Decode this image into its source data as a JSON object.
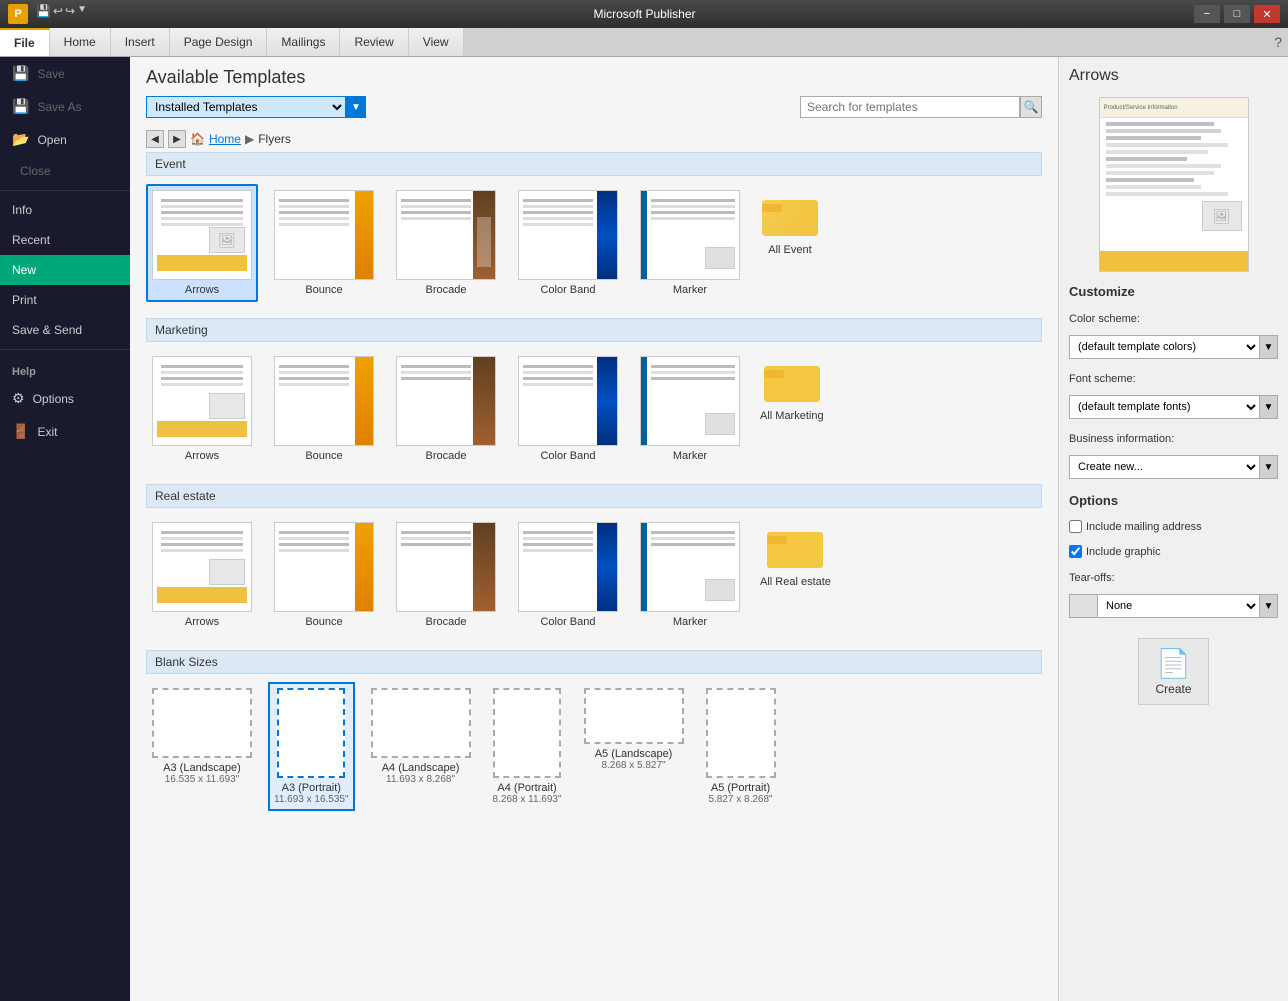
{
  "titlebar": {
    "icon": "P",
    "title": "Microsoft Publisher",
    "minimize": "−",
    "maximize": "□",
    "close": "✕"
  },
  "ribbon": {
    "tabs": [
      {
        "label": "File",
        "active": true
      },
      {
        "label": "Home",
        "active": false
      },
      {
        "label": "Insert",
        "active": false
      },
      {
        "label": "Page Design",
        "active": false
      },
      {
        "label": "Mailings",
        "active": false
      },
      {
        "label": "Review",
        "active": false
      },
      {
        "label": "View",
        "active": false
      }
    ]
  },
  "sidebar": {
    "items": [
      {
        "label": "Save",
        "icon": "💾",
        "disabled": true
      },
      {
        "label": "Save As",
        "icon": "💾",
        "disabled": true
      },
      {
        "label": "Open",
        "icon": "📂",
        "disabled": false
      },
      {
        "label": "Close",
        "icon": "✕",
        "disabled": true
      },
      {
        "label": "Info",
        "section": true
      },
      {
        "label": "Recent",
        "section": true
      },
      {
        "label": "New",
        "active": true
      },
      {
        "label": "Print",
        "section": true
      },
      {
        "label": "Save & Send",
        "section": true
      },
      {
        "label": "Help",
        "section_header": true
      },
      {
        "label": "Options",
        "icon": "⚙"
      },
      {
        "label": "Exit",
        "icon": "✕"
      }
    ]
  },
  "main": {
    "title": "Available Templates",
    "template_source": "Installed Templates",
    "search_placeholder": "Search for templates",
    "breadcrumb": {
      "home": "Home",
      "current": "Flyers"
    },
    "sections": [
      {
        "name": "Event",
        "templates": [
          {
            "label": "Arrows",
            "selected": true,
            "type": "arrows"
          },
          {
            "label": "Bounce",
            "type": "bounce"
          },
          {
            "label": "Brocade",
            "type": "brocade"
          },
          {
            "label": "Color Band",
            "type": "colorband"
          },
          {
            "label": "Marker",
            "type": "marker"
          }
        ],
        "folder": {
          "label": "All Event"
        }
      },
      {
        "name": "Marketing",
        "templates": [
          {
            "label": "Arrows",
            "selected": false,
            "type": "arrows"
          },
          {
            "label": "Bounce",
            "type": "bounce"
          },
          {
            "label": "Brocade",
            "type": "brocade"
          },
          {
            "label": "Color Band",
            "type": "colorband"
          },
          {
            "label": "Marker",
            "type": "marker"
          }
        ],
        "folder": {
          "label": "All Marketing"
        }
      },
      {
        "name": "Real estate",
        "templates": [
          {
            "label": "Arrows",
            "selected": false,
            "type": "arrows"
          },
          {
            "label": "Bounce",
            "type": "bounce"
          },
          {
            "label": "Brocade",
            "type": "brocade"
          },
          {
            "label": "Color Band",
            "type": "colorband"
          },
          {
            "label": "Marker",
            "type": "marker"
          }
        ],
        "folder": {
          "label": "All Real estate"
        }
      },
      {
        "name": "Blank Sizes",
        "blanks": [
          {
            "label": "A3 (Landscape)",
            "size": "16.535 x 11.693\"",
            "shape": "land"
          },
          {
            "label": "A3 (Portrait)",
            "size": "11.693 x 16.535\"",
            "shape": "port",
            "selected": true
          },
          {
            "label": "A4 (Landscape)",
            "size": "11.693 x 8.268\"",
            "shape": "land"
          },
          {
            "label": "A4 (Portrait)",
            "size": "8.268 x 11.693\"",
            "shape": "port"
          },
          {
            "label": "A5 (Landscape)",
            "size": "8.268 x 5.827\"",
            "shape": "land5"
          },
          {
            "label": "A5 (Portrait)",
            "size": "5.827 x 8.268\"",
            "shape": "port5"
          }
        ]
      }
    ]
  },
  "right_panel": {
    "title": "Arrows",
    "customize": {
      "title": "Customize",
      "color_scheme_label": "Color scheme:",
      "color_scheme_value": "(default template colors)",
      "font_scheme_label": "Font scheme:",
      "font_scheme_value": "(default template fonts)",
      "business_info_label": "Business information:",
      "business_info_value": "Create new..."
    },
    "options": {
      "title": "Options",
      "include_mailing": "Include mailing address",
      "include_mailing_checked": false,
      "include_graphic": "Include graphic",
      "include_graphic_checked": true,
      "tearoffs_label": "Tear-offs:",
      "tearoffs_value": "None"
    },
    "create_button": "Create"
  }
}
